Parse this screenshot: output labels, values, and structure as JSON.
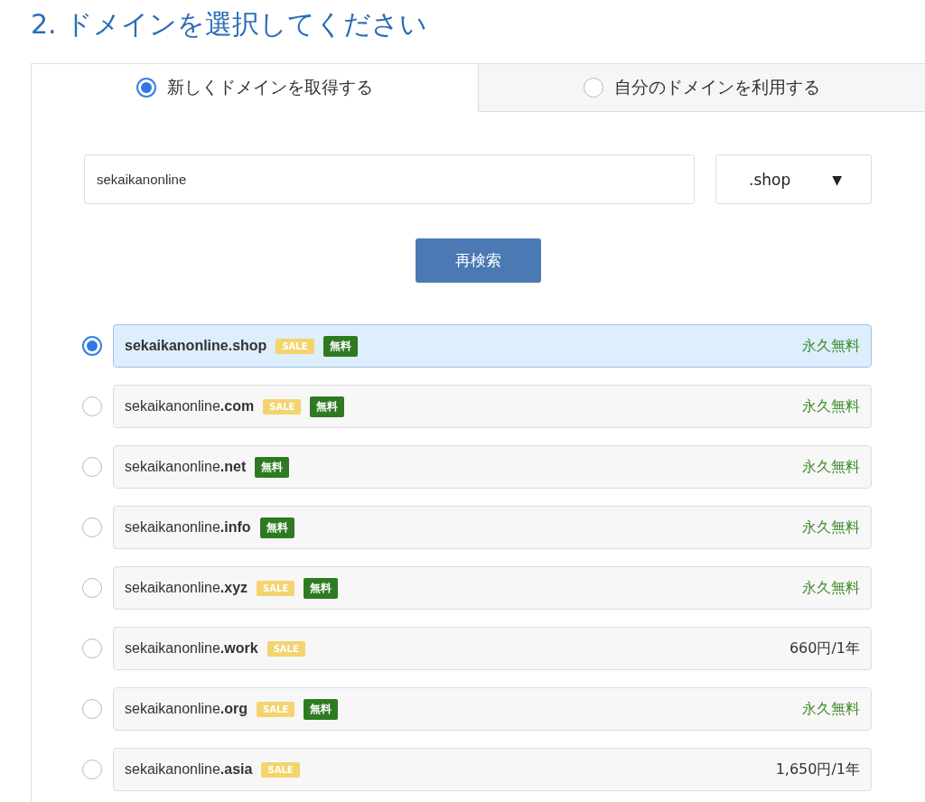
{
  "title": "2. ドメインを選択してください",
  "tabs": [
    {
      "label": "新しくドメインを取得する",
      "selected": true
    },
    {
      "label": "自分のドメインを利用する",
      "selected": false
    }
  ],
  "search": {
    "value": "sekaikanonline"
  },
  "tld_select": {
    "value": ".shop",
    "caret": "▼"
  },
  "search_button": "再検索",
  "domains": [
    {
      "name": "sekaikanonline.shop",
      "selected": true,
      "badges": [
        {
          "kind": "sale",
          "text": "SALE"
        },
        {
          "kind": "free",
          "text": "無料"
        }
      ],
      "price": {
        "kind": "free",
        "text": "永久無料"
      }
    },
    {
      "name": "sekaikanonline**.com**",
      "selected": false,
      "badges": [
        {
          "kind": "sale",
          "text": "SALE"
        },
        {
          "kind": "free",
          "text": "無料"
        }
      ],
      "price": {
        "kind": "free",
        "text": "永久無料"
      }
    },
    {
      "name": "sekaikanonline**.net**",
      "selected": false,
      "badges": [
        {
          "kind": "free",
          "text": "無料"
        }
      ],
      "price": {
        "kind": "free",
        "text": "永久無料"
      }
    },
    {
      "name": "sekaikanonline**.info**",
      "selected": false,
      "badges": [
        {
          "kind": "free",
          "text": "無料"
        }
      ],
      "price": {
        "kind": "free",
        "text": "永久無料"
      }
    },
    {
      "name": "sekaikanonline**.xyz**",
      "selected": false,
      "badges": [
        {
          "kind": "sale",
          "text": "SALE"
        },
        {
          "kind": "free",
          "text": "無料"
        }
      ],
      "price": {
        "kind": "free",
        "text": "永久無料"
      }
    },
    {
      "name": "sekaikanonline**.work**",
      "selected": false,
      "badges": [
        {
          "kind": "sale",
          "text": "SALE"
        }
      ],
      "price": {
        "kind": "paid",
        "text": "660円/1年"
      }
    },
    {
      "name": "sekaikanonline**.org**",
      "selected": false,
      "badges": [
        {
          "kind": "sale",
          "text": "SALE"
        },
        {
          "kind": "free",
          "text": "無料"
        }
      ],
      "price": {
        "kind": "free",
        "text": "永久無料"
      }
    },
    {
      "name": "sekaikanonline**.asia**",
      "selected": false,
      "badges": [
        {
          "kind": "sale",
          "text": "SALE"
        }
      ],
      "price": {
        "kind": "paid",
        "text": "1,650円/1年"
      }
    }
  ]
}
